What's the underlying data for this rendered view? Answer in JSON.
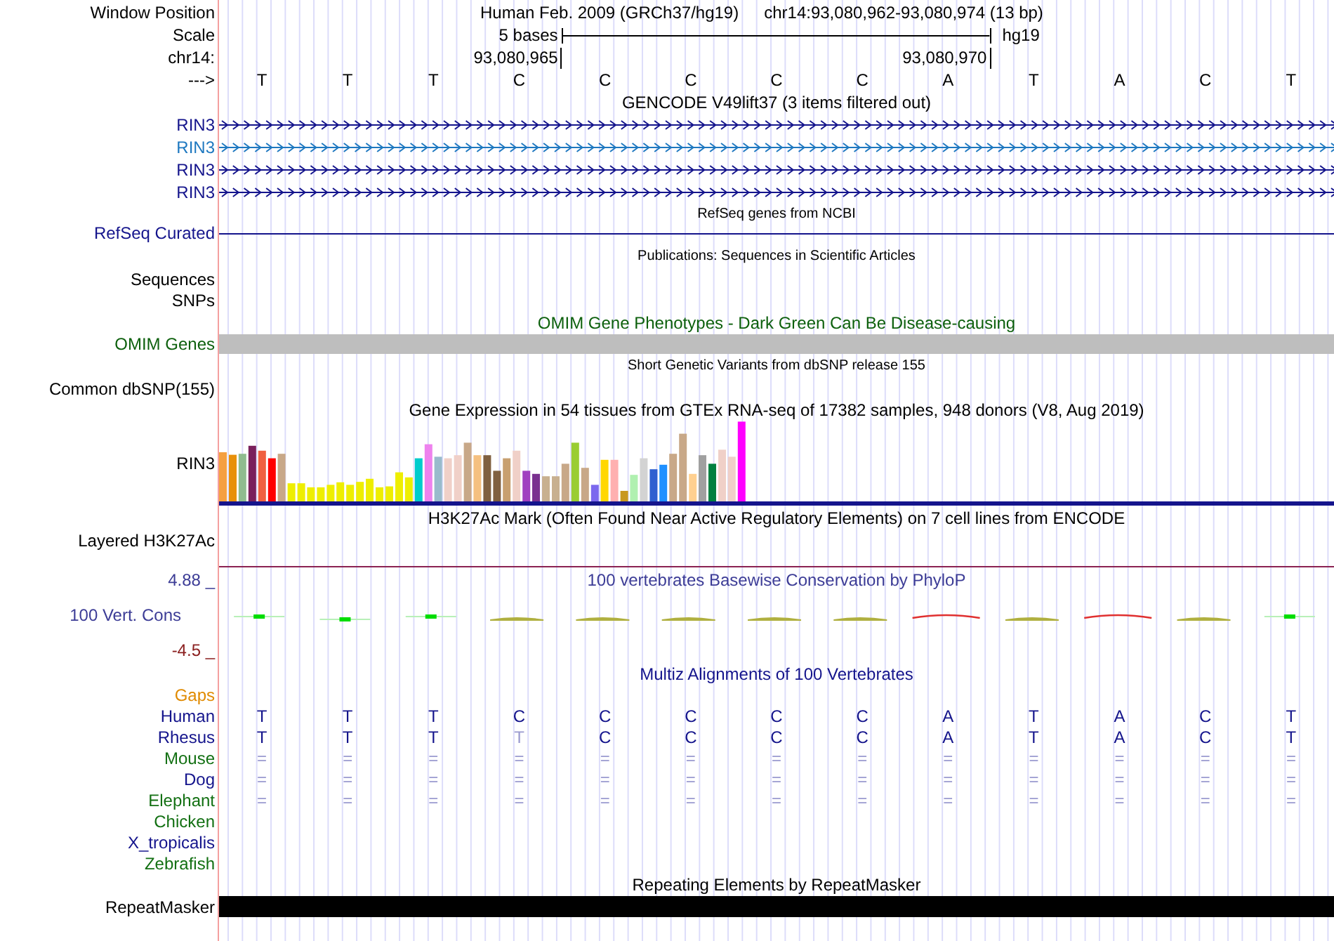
{
  "header": {
    "window_position_label": "Window Position",
    "assembly": "Human Feb. 2009 (GRCh37/hg19)",
    "position": "chr14:93,080,962-93,080,974 (13 bp)",
    "scale_label": "Scale",
    "scale_text": "5 bases",
    "scale_db": "hg19",
    "chrom_label": "chr14:",
    "ticks": [
      "93,080,965",
      "93,080,970"
    ],
    "strand_label": "--->",
    "bases": [
      "T",
      "T",
      "T",
      "C",
      "C",
      "C",
      "C",
      "C",
      "A",
      "T",
      "A",
      "C",
      "T"
    ]
  },
  "gencode": {
    "title": "GENCODE V49lift37 (3 items filtered out)",
    "items": [
      {
        "name": "RIN3",
        "color": "#14148c"
      },
      {
        "name": "RIN3",
        "color": "#1e78c0"
      },
      {
        "name": "RIN3",
        "color": "#14148c"
      },
      {
        "name": "RIN3",
        "color": "#14148c"
      }
    ]
  },
  "refseq": {
    "title": "RefSeq genes from NCBI",
    "label": "RefSeq Curated"
  },
  "publications": {
    "title": "Publications: Sequences in Scientific Articles",
    "labels": [
      "Sequences",
      "SNPs"
    ]
  },
  "omim": {
    "title": "OMIM Gene Phenotypes - Dark Green Can Be Disease-causing",
    "label": "OMIM Genes"
  },
  "dbsnp": {
    "title": "Short Genetic Variants from dbSNP release 155",
    "label": "Common dbSNP(155)"
  },
  "gtex": {
    "title": "Gene Expression in 54 tissues from GTEx RNA-seq of 17382 samples, 948 donors (V8, Aug 2019)",
    "label": "RIN3"
  },
  "h3k27ac": {
    "title": "H3K27Ac Mark (Often Found Near Active Regulatory Elements) on 7 cell lines from ENCODE",
    "label": "Layered H3K27Ac"
  },
  "phylop": {
    "title": "100 vertebrates Basewise Conservation by PhyloP",
    "label": "100 Vert. Cons",
    "max_label": "4.88 _",
    "min_label": "-4.5 _"
  },
  "multiz": {
    "title": "Multiz Alignments of 100 Vertebrates",
    "gaps_label": "Gaps",
    "species": [
      {
        "name": "Human",
        "color": "#14148c",
        "kind": "bases",
        "bases": [
          "T",
          "T",
          "T",
          "C",
          "C",
          "C",
          "C",
          "C",
          "A",
          "T",
          "A",
          "C",
          "T"
        ],
        "faded": [
          false,
          false,
          false,
          false,
          false,
          false,
          false,
          false,
          false,
          false,
          false,
          false,
          false
        ]
      },
      {
        "name": "Rhesus",
        "color": "#14148c",
        "kind": "bases",
        "bases": [
          "T",
          "T",
          "T",
          "T",
          "C",
          "C",
          "C",
          "C",
          "A",
          "T",
          "A",
          "C",
          "T"
        ],
        "faded": [
          false,
          false,
          false,
          true,
          false,
          false,
          false,
          false,
          false,
          false,
          false,
          false,
          false
        ]
      },
      {
        "name": "Mouse",
        "color": "#137013",
        "kind": "bases",
        "bases": [
          "=",
          "=",
          "=",
          "=",
          "=",
          "=",
          "=",
          "=",
          "=",
          "=",
          "=",
          "=",
          "="
        ],
        "faded": [
          true,
          true,
          true,
          true,
          true,
          true,
          true,
          true,
          true,
          true,
          true,
          true,
          true
        ]
      },
      {
        "name": "Dog",
        "color": "#14148c",
        "kind": "bases",
        "bases": [
          "=",
          "=",
          "=",
          "=",
          "=",
          "=",
          "=",
          "=",
          "=",
          "=",
          "=",
          "=",
          "="
        ],
        "faded": [
          true,
          true,
          true,
          true,
          true,
          true,
          true,
          true,
          true,
          true,
          true,
          true,
          true
        ]
      },
      {
        "name": "Elephant",
        "color": "#137013",
        "kind": "bases",
        "bases": [
          "=",
          "=",
          "=",
          "=",
          "=",
          "=",
          "=",
          "=",
          "=",
          "=",
          "=",
          "=",
          "="
        ],
        "faded": [
          true,
          true,
          true,
          true,
          true,
          true,
          true,
          true,
          true,
          true,
          true,
          true,
          true
        ]
      },
      {
        "name": "Chicken",
        "color": "#137013",
        "kind": "none"
      },
      {
        "name": "X_tropicalis",
        "color": "#14148c",
        "kind": "none"
      },
      {
        "name": "Zebrafish",
        "color": "#137013",
        "kind": "none"
      }
    ]
  },
  "repeatmasker": {
    "title": "Repeating Elements by RepeatMasker",
    "label": "RepeatMasker"
  }
}
